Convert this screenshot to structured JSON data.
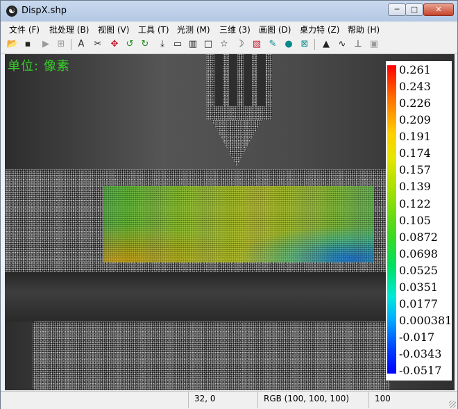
{
  "window": {
    "title": "DispX.shp",
    "min_glyph": "─",
    "max_glyph": "□",
    "close_glyph": "✕"
  },
  "menu": [
    {
      "label": "文件 (F)"
    },
    {
      "label": "批处理 (B)"
    },
    {
      "label": "视图 (V)"
    },
    {
      "label": "工具 (T)"
    },
    {
      "label": "光测 (M)"
    },
    {
      "label": "三维 (3)"
    },
    {
      "label": "画图 (D)"
    },
    {
      "label": "桌力特 (Z)"
    },
    {
      "label": "帮助 (H)"
    }
  ],
  "toolbar": [
    {
      "icon": "open-folder-icon",
      "glyph": "📂"
    },
    {
      "icon": "save-icon",
      "glyph": "▪"
    },
    {
      "icon": "play-icon",
      "glyph": "▶"
    },
    {
      "icon": "tile-icon",
      "glyph": "⊞"
    },
    {
      "icon": "text-icon",
      "glyph": "A"
    },
    {
      "icon": "scissors-icon",
      "glyph": "✂"
    },
    {
      "icon": "move-icon",
      "glyph": "✥"
    },
    {
      "icon": "rotate-left-icon",
      "glyph": "↺"
    },
    {
      "icon": "rotate-right-icon",
      "glyph": "↻"
    },
    {
      "icon": "download-icon",
      "glyph": "⤓"
    },
    {
      "icon": "ruler-icon",
      "glyph": "▭"
    },
    {
      "icon": "histogram-icon",
      "glyph": "▥"
    },
    {
      "icon": "rectangle-icon",
      "glyph": "□"
    },
    {
      "icon": "star-icon",
      "glyph": "☆"
    },
    {
      "icon": "moon-icon",
      "glyph": "☽"
    },
    {
      "icon": "color-map-icon",
      "glyph": "▨"
    },
    {
      "icon": "pencil-icon",
      "glyph": "✎"
    },
    {
      "icon": "circle-icon",
      "glyph": "●"
    },
    {
      "icon": "mesh-icon",
      "glyph": "⊠"
    },
    {
      "icon": "peak-icon",
      "glyph": "▲"
    },
    {
      "icon": "wave-icon",
      "glyph": "∿"
    },
    {
      "icon": "axes-icon",
      "glyph": "⊥"
    },
    {
      "icon": "cube-icon",
      "glyph": "▣"
    }
  ],
  "viewport": {
    "unit_label": "单位: 像素"
  },
  "colorbar": {
    "labels": [
      "0.261",
      "0.243",
      "0.226",
      "0.209",
      "0.191",
      "0.174",
      "0.157",
      "0.139",
      "0.122",
      "0.105",
      "0.0872",
      "0.0698",
      "0.0525",
      "0.0351",
      "0.0177",
      "0.000381",
      "-0.017",
      "-0.0343",
      "-0.0517"
    ]
  },
  "status": {
    "cell1": "",
    "coords": "32, 0",
    "color": "RGB (100, 100, 100)",
    "zoom": "100"
  }
}
